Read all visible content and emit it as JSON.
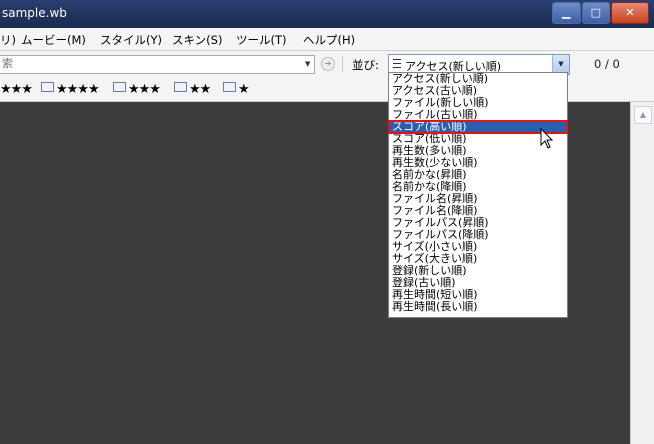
{
  "window": {
    "title": "sample.wb",
    "min": "▁",
    "max": "□",
    "close": "✕"
  },
  "menu": [
    "リ)",
    "ムービー(M)",
    "スタイル(Y)",
    "スキン(S)",
    "ツール(T)",
    "ヘルプ(H)"
  ],
  "search": {
    "placeholder": "索",
    "dropdown_icon": "chevron-down-icon",
    "button_icon": "search-go-icon"
  },
  "sort": {
    "label": "並び:",
    "selected": "アクセス(新しい順)",
    "options": [
      "アクセス(新しい順)",
      "アクセス(古い順)",
      "ファイル(新しい順)",
      "ファイル(古い順)",
      "スコア(高い順)",
      "スコア(低い順)",
      "再生数(多い順)",
      "再生数(少ない順)",
      "名前かな(昇順)",
      "名前かな(降順)",
      "ファイル名(昇順)",
      "ファイル名(降順)",
      "ファイルパス(昇順)",
      "ファイルパス(降順)",
      "サイズ(小さい順)",
      "サイズ(大きい順)",
      "登録(新しい順)",
      "登録(古い順)",
      "再生時間(短い順)",
      "再生時間(長い順)"
    ],
    "highlighted_index": 4
  },
  "counter": "0 / 0",
  "ratings": {
    "r3a": "★★★",
    "r4": "★★★★",
    "r3b": "★★★",
    "r2": "★★",
    "r1": "★"
  },
  "colors": {
    "selection": "#2a5fb0",
    "highlight_border": "#e41414",
    "content_bg": "#3d3d3d"
  }
}
